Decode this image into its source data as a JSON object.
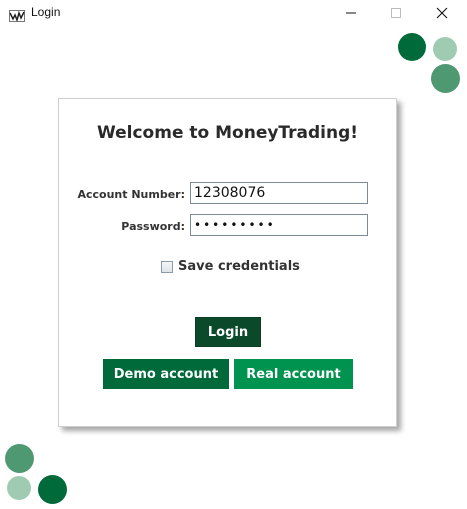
{
  "window": {
    "title": "Login",
    "minimize": "—",
    "maximize": "☐",
    "close": "✕"
  },
  "form": {
    "welcome": "Welcome to MoneyTrading!",
    "account_label": "Account Number:",
    "account_value": "12308076",
    "password_label": "Password:",
    "password_value": "•••••••••",
    "save_label": "Save credentials",
    "save_checked": false
  },
  "buttons": {
    "login": "Login",
    "demo": "Demo account",
    "real": "Real account"
  },
  "colors": {
    "dark_green": "#006a3a",
    "mid_green": "#4e9872",
    "light_green": "#9fcbb2",
    "login_button": "#0a4a2a",
    "real_button": "#00934f"
  }
}
